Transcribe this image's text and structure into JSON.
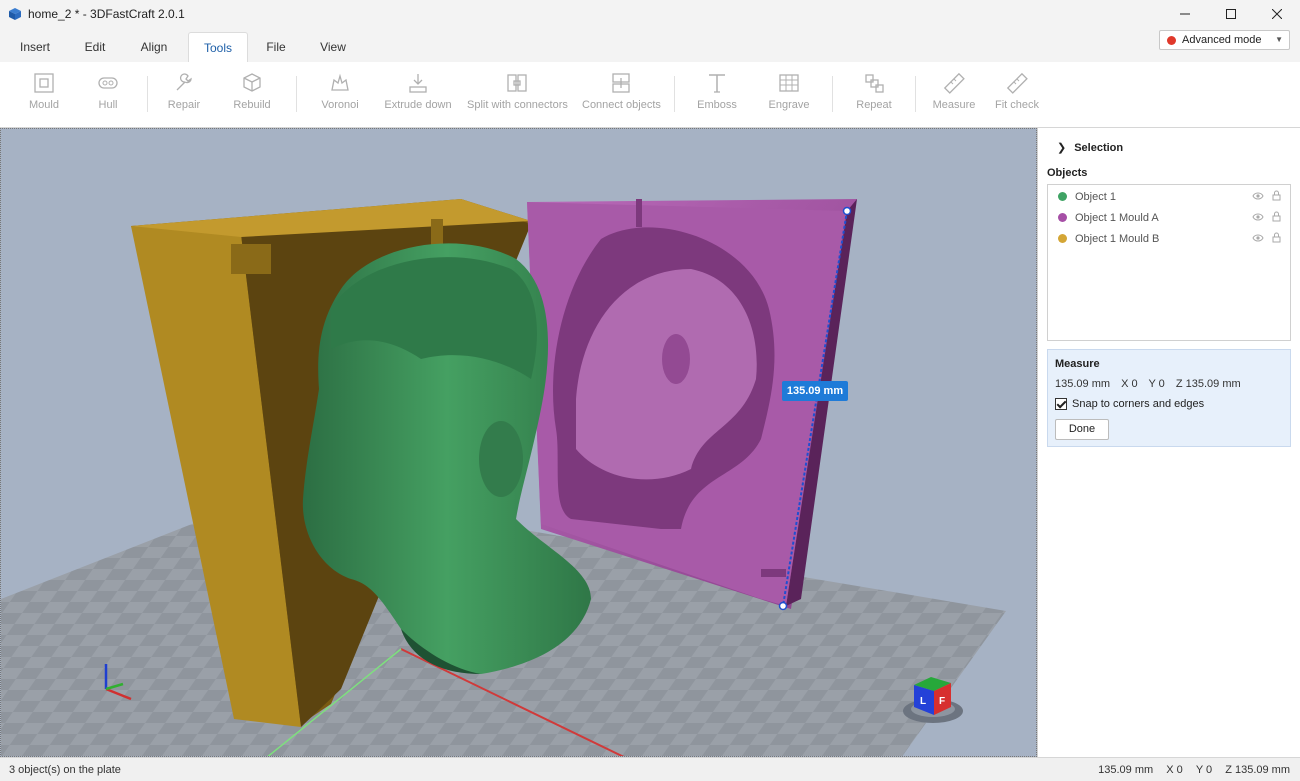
{
  "window": {
    "title": "home_2 * - 3DFastCraft 2.0.1",
    "minimize": "—",
    "maximize": "☐",
    "close": "✕"
  },
  "tabs": [
    {
      "label": "Insert",
      "active": false
    },
    {
      "label": "Edit",
      "active": false
    },
    {
      "label": "Align",
      "active": false
    },
    {
      "label": "Tools",
      "active": true
    },
    {
      "label": "File",
      "active": false
    },
    {
      "label": "View",
      "active": false
    }
  ],
  "mode": {
    "label": "Advanced mode",
    "color": "#e0392b"
  },
  "toolbar": [
    {
      "label": "Mould",
      "icon": "mould-icon"
    },
    {
      "label": "Hull",
      "icon": "hull-icon"
    },
    {
      "label": "Repair",
      "icon": "wrench-icon"
    },
    {
      "label": "Rebuild",
      "icon": "cube-icon"
    },
    {
      "label": "Voronoi",
      "icon": "voronoi-icon"
    },
    {
      "label": "Extrude down",
      "icon": "extrude-icon"
    },
    {
      "label": "Split with connectors",
      "icon": "split-icon"
    },
    {
      "label": "Connect objects",
      "icon": "connect-icon"
    },
    {
      "label": "Emboss",
      "icon": "text-icon"
    },
    {
      "label": "Engrave",
      "icon": "grid-icon"
    },
    {
      "label": "Repeat",
      "icon": "repeat-icon"
    },
    {
      "label": "Measure",
      "icon": "ruler-icon"
    },
    {
      "label": "Fit check",
      "icon": "fit-check-icon"
    }
  ],
  "viewport": {
    "dimension_label": "135.09 mm",
    "colors": {
      "background": "#a6b2c4",
      "object_1": "#3d8a57",
      "mould_a": "#a052a0",
      "mould_b": "#a98620"
    }
  },
  "panel": {
    "selection_label": "Selection",
    "objects_label": "Objects",
    "objects": [
      {
        "name": "Object 1",
        "color": "#3fa364"
      },
      {
        "name": "Object 1 Mould A",
        "color": "#a64fa6"
      },
      {
        "name": "Object 1 Mould B",
        "color": "#d4a636"
      }
    ],
    "measure": {
      "title": "Measure",
      "length": "135.09 mm",
      "x": "X 0",
      "y": "Y 0",
      "z": "Z 135.09 mm",
      "snap_label": "Snap to corners and edges",
      "snap_checked": true,
      "done_label": "Done"
    }
  },
  "status": {
    "left": "3 object(s) on the plate",
    "length": "135.09 mm",
    "x": "X 0",
    "y": "Y 0",
    "z": "Z 135.09 mm"
  }
}
